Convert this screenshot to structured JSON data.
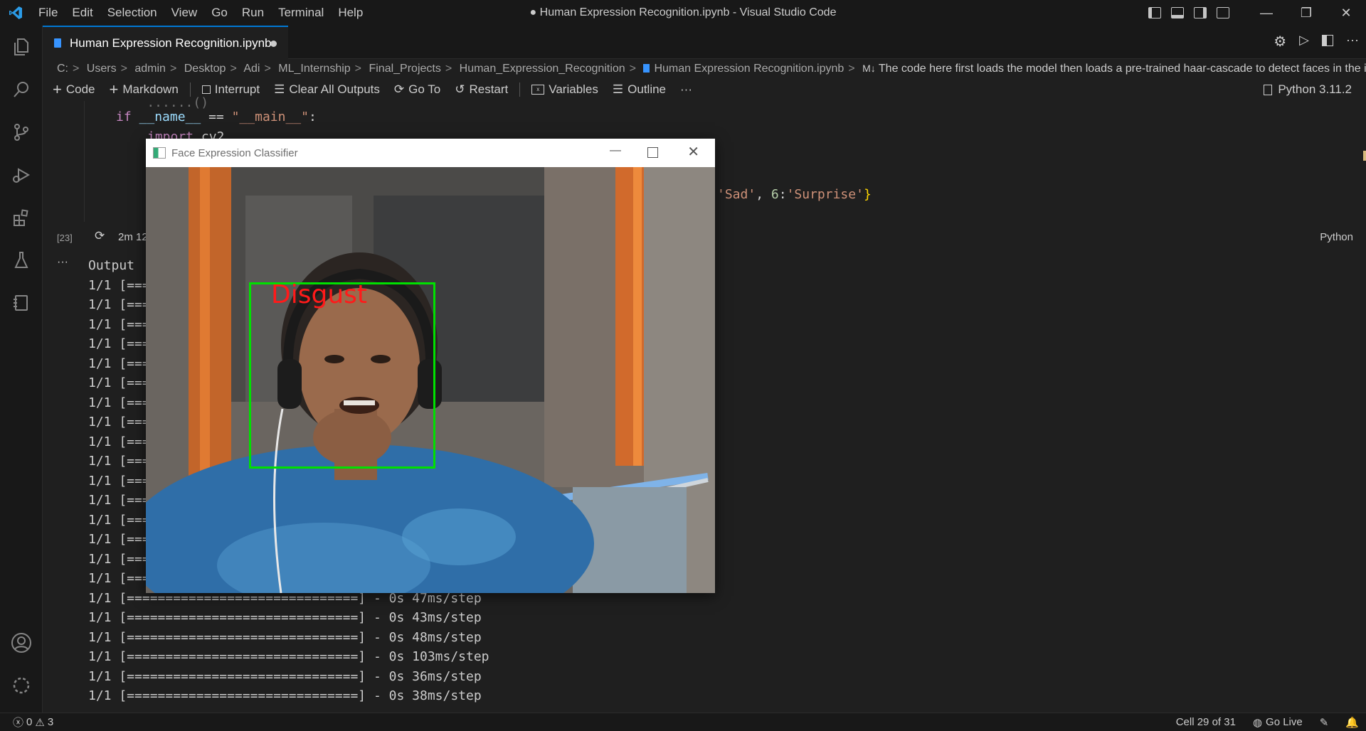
{
  "window": {
    "title": "● Human Expression Recognition.ipynb - Visual Studio Code",
    "menu": [
      "File",
      "Edit",
      "Selection",
      "View",
      "Go",
      "Run",
      "Terminal",
      "Help"
    ]
  },
  "tab": {
    "label": "Human Expression Recognition.ipynb"
  },
  "breadcrumb": {
    "items": [
      "C:",
      "Users",
      "admin",
      "Desktop",
      "Adi",
      "ML_Internship",
      "Final_Projects",
      "Human_Expression_Recognition",
      "Human Expression Recognition.ipynb"
    ],
    "markdown_prefix": "M↓",
    "last": "The code here first loads the model then loads a pre-trained haar-cascade to detect faces in the image"
  },
  "toolbar": {
    "code": "Code",
    "markdown": "Markdown",
    "interrupt": "Interrupt",
    "clear_outputs": "Clear All Outputs",
    "go_to": "Go To",
    "restart": "Restart",
    "variables": "Variables",
    "outline": "Outline",
    "more": "···",
    "kernel": "Python 3.11.2"
  },
  "code": {
    "line1_name": "__name__",
    "line1_op": " == ",
    "line1_str": "\"__main__\"",
    "line2": "cv2",
    "dict_tail_str1": "'Sad'",
    "dict_tail_num": "6",
    "dict_tail_str2": "'Surprise'"
  },
  "cell": {
    "exec_count": "[23]",
    "duration": "2m 12",
    "language": "Python"
  },
  "output": {
    "header": "Output",
    "visible_lines": [
      "1/1 [==============================] - 0s 47ms/step",
      "1/1 [==============================] - 0s 43ms/step",
      "1/1 [==============================] - 0s 48ms/step",
      "1/1 [==============================] - 0s 103ms/step",
      "1/1 [==============================] - 0s 36ms/step",
      "1/1 [==============================] - 0s 38ms/step"
    ],
    "hidden_prefix": "1/1 [==="
  },
  "classifier_window": {
    "title": "Face Expression Classifier",
    "prediction_label": "Disgust",
    "box_color": "#00e000",
    "label_color": "#ff1a1a"
  },
  "statusbar": {
    "errors": "0",
    "warnings": "3",
    "cell_position": "Cell 29 of 31",
    "go_live": "Go Live"
  },
  "colors": {
    "accent": "#0078d4",
    "background": "#1f1f1f"
  }
}
